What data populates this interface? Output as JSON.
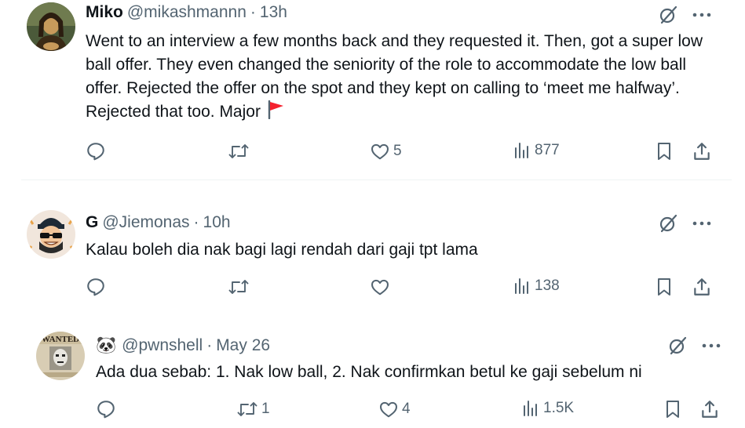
{
  "tweets": [
    {
      "name": "Miko",
      "handle": "@mikashmannn",
      "sep": "·",
      "time": "13h",
      "text": "Went to an interview a few months back and they requested it. Then, got a super low ball offer. They even changed the seniority of the role to accommodate the low ball offer. Rejected the offer on the spot and they kept on calling to ‘meet me halfway’. Rejected that too. Major",
      "emoji": "red-flag",
      "replies": "",
      "reposts": "",
      "likes": "5",
      "views": "877"
    },
    {
      "name": "G",
      "handle": "@Jiemonas",
      "sep": "·",
      "time": "10h",
      "text": "Kalau boleh dia nak bagi lagi rendah dari gaji tpt lama",
      "replies": "",
      "reposts": "",
      "likes": "",
      "views": "138"
    },
    {
      "name": "🐼",
      "handle": "@pwnshell",
      "sep": "·",
      "time": "May 26",
      "text": "Ada dua sebab: 1. Nak low ball, 2. Nak confirmkan betul ke gaji sebelum ni",
      "replies": "",
      "reposts": "1",
      "likes": "4",
      "views": "1.5K",
      "avatar_text": "WANTED"
    }
  ],
  "colors": {
    "text": "#0f1419",
    "muted": "#536471",
    "divider": "#eff3f4",
    "flag": "#f4212e"
  },
  "icons": [
    "reply-icon",
    "repost-icon",
    "like-icon",
    "views-icon",
    "bookmark-icon",
    "share-icon",
    "grok-icon",
    "more-icon"
  ]
}
